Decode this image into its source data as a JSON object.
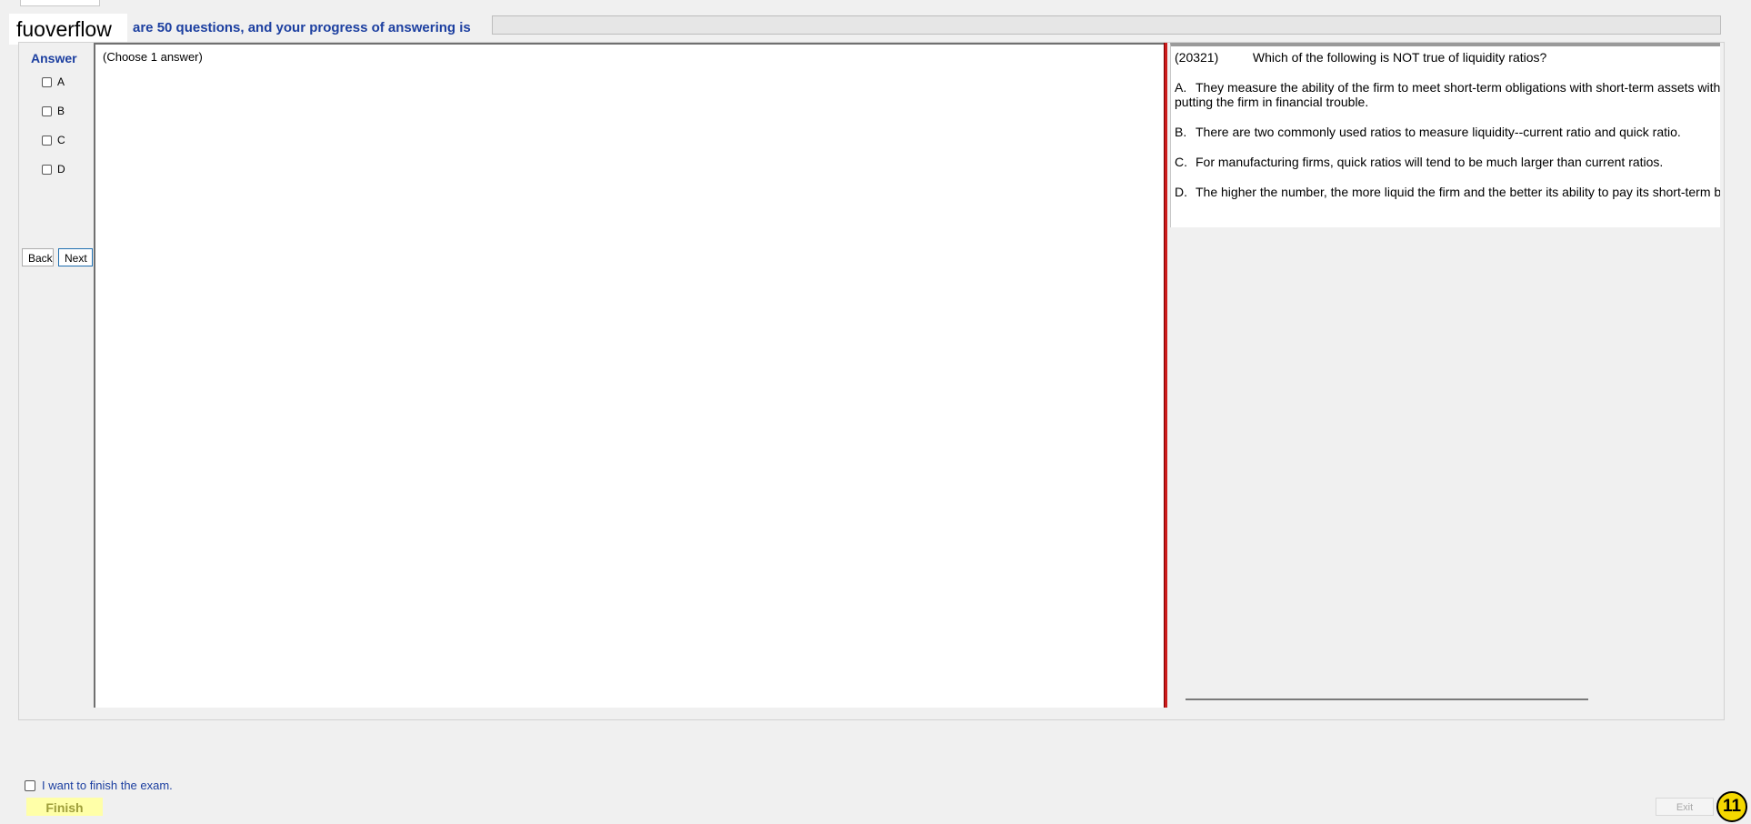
{
  "header": {
    "logo_text": "fuoverflow",
    "progress_text": "are 50 questions, and your progress of answering is",
    "progress_fraction": 0
  },
  "answer_panel": {
    "title": "Answer",
    "options": [
      "A",
      "B",
      "C",
      "D"
    ],
    "back_label": "Back",
    "next_label": "Next"
  },
  "work_area": {
    "hint": "(Choose 1 answer)"
  },
  "question": {
    "id": "(20321)",
    "stem": "Which of the following is NOT true of liquidity ratios?",
    "choices": [
      {
        "letter": "A.",
        "text": "They measure the ability of the firm to meet short-term obligations with short-term assets without putting the firm in financial trouble."
      },
      {
        "letter": "B.",
        "text": "There are two commonly used ratios to measure liquidity--current ratio and quick ratio."
      },
      {
        "letter": "C.",
        "text": "For manufacturing firms, quick ratios will tend to be much larger than current ratios."
      },
      {
        "letter": "D.",
        "text": "The higher the number, the more liquid the firm and the better its ability to pay its short-term bills."
      }
    ]
  },
  "footer": {
    "finish_check_label": "I want to finish the exam.",
    "finish_label": "Finish",
    "exit_label": "Exit"
  },
  "badge": {
    "number": "11"
  },
  "colors": {
    "accent_blue": "#1c3fa0",
    "divider_red": "#cc1c1c",
    "finish_yellow": "#ffffa8",
    "badge_yellow": "#f5d800"
  }
}
